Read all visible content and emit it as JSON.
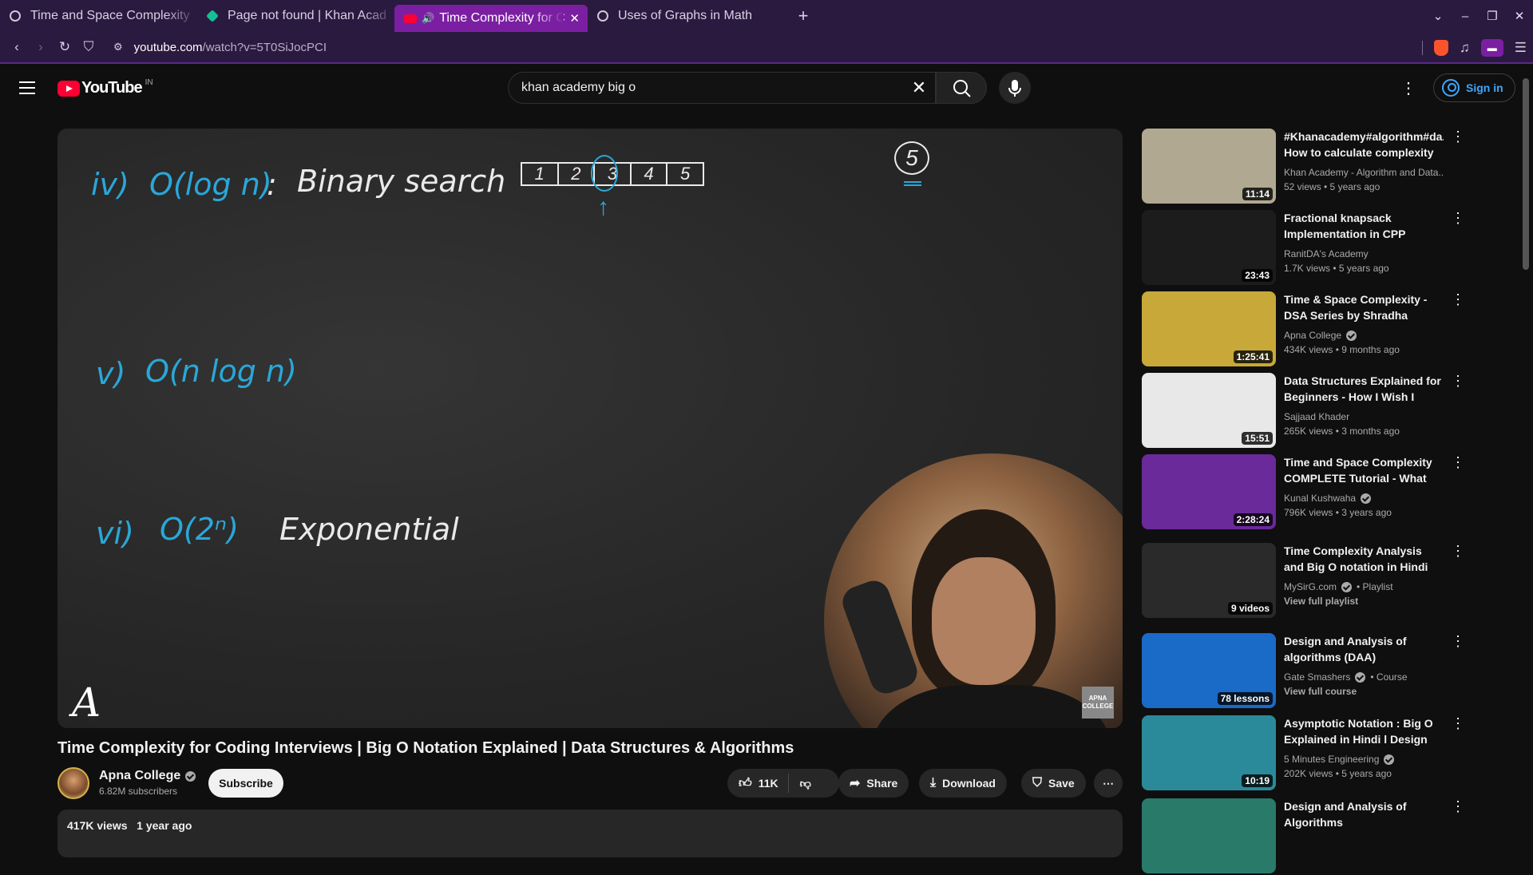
{
  "browser": {
    "tabs": [
      {
        "title": "Time and Space Complexity",
        "active": false
      },
      {
        "title": "Page not found | Khan Acad",
        "active": false
      },
      {
        "title": "Time Complexity for C",
        "active": true
      },
      {
        "title": "Uses of Graphs in Math",
        "active": false
      }
    ],
    "url_host": "youtube.com",
    "url_path": "/watch?v=5T0SiJocPCI"
  },
  "youtube": {
    "logo_text": "YouTube",
    "country": "IN",
    "search_query": "khan academy big o",
    "sign_in": "Sign in"
  },
  "video": {
    "board": {
      "line1_num": "iv)",
      "line1_expr": "O(log n)",
      "line1_colon": ":",
      "line1_desc": "Binary search",
      "array": [
        "1",
        "2",
        "3",
        "4",
        "5"
      ],
      "circle_value": "5",
      "line2_num": "v)",
      "line2_expr": "O(n log n)",
      "line3_num": "vi)",
      "line3_expr": "O(2ⁿ)",
      "line3_desc": "Exponential",
      "watermark_letter": "A",
      "corner_logo": "APNA COLLEGE"
    },
    "title": "Time Complexity for Coding Interviews | Big O Notation Explained | Data Structures & Algorithms",
    "channel": "Apna College",
    "subscribers": "6.82M subscribers",
    "subscribe_label": "Subscribe",
    "likes": "11K",
    "share_label": "Share",
    "download_label": "Download",
    "save_label": "Save",
    "views": "417K views",
    "age": "1 year ago"
  },
  "related": [
    {
      "title": "#Khanacademy#algorithm#da... How to calculate complexity o...",
      "channel": "Khan Academy - Algorithm and Data...",
      "meta": "52 views • 5 years ago",
      "duration": "11:14",
      "verified": false,
      "thumb": "#b0a890"
    },
    {
      "title": "Fractional knapsack Implementation in CPP",
      "channel": "RanitDA's Academy",
      "meta": "1.7K views • 5 years ago",
      "duration": "23:43",
      "verified": false,
      "thumb": "#1c1c1c"
    },
    {
      "title": "Time & Space Complexity - DSA Series by Shradha Ma'am",
      "channel": "Apna College",
      "meta": "434K views • 9 months ago",
      "duration": "1:25:41",
      "verified": true,
      "thumb": "#c8a838"
    },
    {
      "title": "Data Structures Explained for Beginners - How I Wish I was...",
      "channel": "Sajjaad Khader",
      "meta": "265K views • 3 months ago",
      "duration": "15:51",
      "verified": false,
      "thumb": "#e8e8e8"
    },
    {
      "title": "Time and Space Complexity COMPLETE Tutorial - What is...",
      "channel": "Kunal Kushwaha",
      "meta": "796K views • 3 years ago",
      "duration": "2:28:24",
      "verified": true,
      "thumb": "#6a2a9a"
    },
    {
      "title": "Time Complexity Analysis and Big O notation in Hindi",
      "channel": "MySirG.com",
      "channel_suffix": "• Playlist",
      "meta": "View full playlist",
      "duration": "9 videos",
      "verified": true,
      "thumb": "#2a2a2a",
      "link": true
    },
    {
      "title": "Design and Analysis of algorithms (DAA)",
      "channel": "Gate Smashers",
      "channel_suffix": "• Course",
      "meta": "View full course",
      "duration": "78 lessons",
      "verified": true,
      "thumb": "#1a6ac8",
      "link": true
    },
    {
      "title": "Asymptotic Notation : Big O Explained in Hindi l Design An...",
      "channel": "5 Minutes Engineering",
      "meta": "202K views • 5 years ago",
      "duration": "10:19",
      "verified": true,
      "thumb": "#2a8a9a"
    },
    {
      "title": "Design and Analysis of Algorithms",
      "channel": "",
      "meta": "",
      "duration": "",
      "verified": false,
      "thumb": "#2a7a6a"
    }
  ]
}
